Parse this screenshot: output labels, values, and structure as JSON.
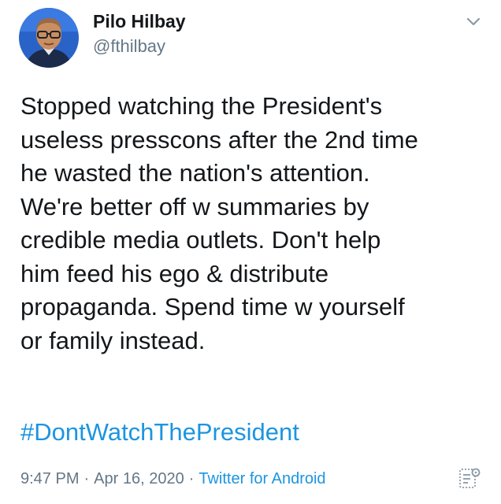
{
  "tweet": {
    "author": {
      "name": "Pilo Hilbay",
      "handle": "@fthilbay"
    },
    "text_lines": [
      "Stopped watching the President's",
      "useless presscons after the 2nd time",
      "he wasted the nation's attention.",
      "We're better off w summaries by",
      "credible media outlets. Don't help",
      "him feed his ego & distribute",
      "propaganda. Spend time w yourself",
      "or family instead."
    ],
    "hashtag": "#DontWatchThePresident",
    "time": "9:47 PM",
    "separator": "·",
    "date": "Apr 16, 2020",
    "source": "Twitter for Android"
  },
  "icons": {
    "more": "chevron-down-icon",
    "analytics": "analytics-icon"
  },
  "colors": {
    "link": "#1b95e0",
    "secondary_text": "#657786",
    "primary_text": "#14171a",
    "background": "#ffffff"
  }
}
